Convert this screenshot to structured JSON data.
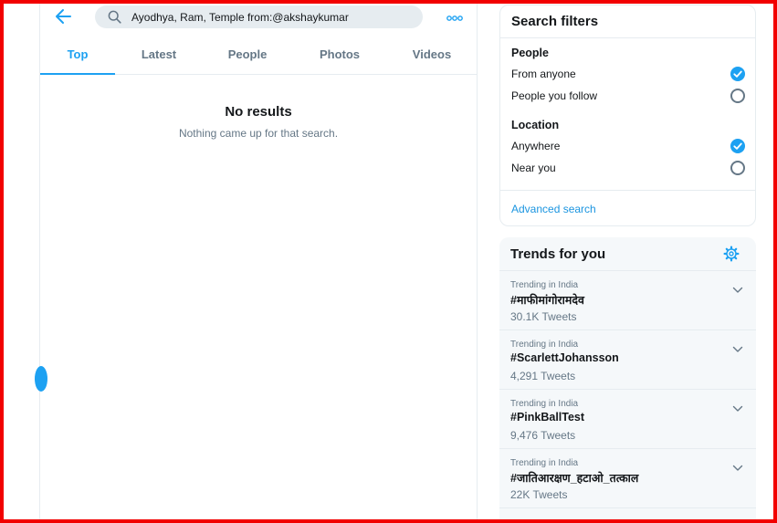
{
  "search": {
    "query": "Ayodhya, Ram, Temple from:@akshaykumar"
  },
  "icons": {
    "back": "arrow-left-icon",
    "search": "magnifier-icon",
    "more": "three-dots-icon",
    "gear": "gear-icon",
    "chevron": "chevron-down-icon"
  },
  "tabs": [
    {
      "label": "Top",
      "active": true
    },
    {
      "label": "Latest",
      "active": false
    },
    {
      "label": "People",
      "active": false
    },
    {
      "label": "Photos",
      "active": false
    },
    {
      "label": "Videos",
      "active": false
    }
  ],
  "results": {
    "title": "No results",
    "message": "Nothing came up for that search."
  },
  "filters": {
    "title": "Search filters",
    "people": {
      "label": "People",
      "options": [
        {
          "label": "From anyone",
          "selected": true
        },
        {
          "label": "People you follow",
          "selected": false
        }
      ]
    },
    "location": {
      "label": "Location",
      "options": [
        {
          "label": "Anywhere",
          "selected": true
        },
        {
          "label": "Near you",
          "selected": false
        }
      ]
    },
    "advanced_link": "Advanced search"
  },
  "trends": {
    "title": "Trends for you",
    "items": [
      {
        "context": "Trending in India",
        "name": "#माफीमांगोरामदेव",
        "count": "30.1K Tweets"
      },
      {
        "context": "Trending in India",
        "name": "#ScarlettJohansson",
        "count": "4,291 Tweets"
      },
      {
        "context": "Trending in India",
        "name": "#PinkBallTest",
        "count": "9,476 Tweets"
      },
      {
        "context": "Trending in India",
        "name": "#जातिआरक्षण_हटाओ_तत्काल",
        "count": "22K Tweets"
      }
    ]
  },
  "colors": {
    "accent": "#1da1f2",
    "link": "#1b95e0",
    "secondary_text": "#657786",
    "border": "#e6ecf0",
    "frame": "#f20000"
  }
}
